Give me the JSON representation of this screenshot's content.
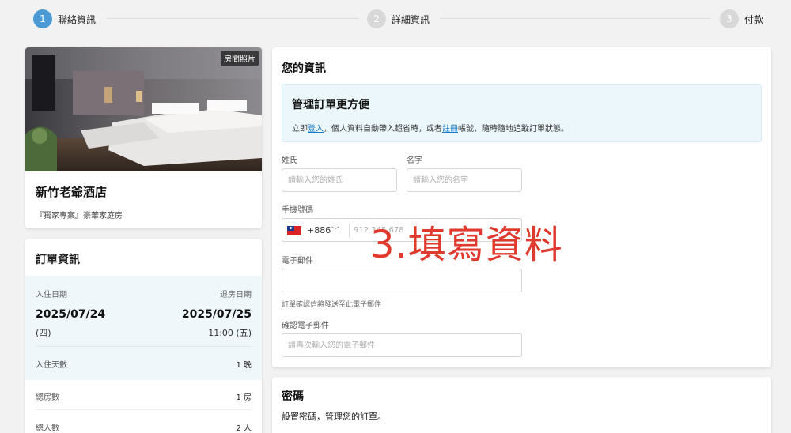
{
  "stepper": {
    "steps": [
      {
        "num": "1",
        "label": "聯絡資訊"
      },
      {
        "num": "2",
        "label": "詳細資訊"
      },
      {
        "num": "3",
        "label": "付款"
      }
    ]
  },
  "hotel": {
    "photo_badge": "房間照片",
    "name": "新竹老爺酒店",
    "room_type": "『獨家專案』豪華家庭房"
  },
  "order": {
    "title": "訂單資訊",
    "checkin_label": "入住日期",
    "checkout_label": "退房日期",
    "checkin_date": "2025/07/24",
    "checkin_sub": "(四)",
    "checkout_date": "2025/07/25",
    "checkout_sub": "11:00 (五)",
    "rows": [
      {
        "label": "入住天數",
        "value": "1 晚"
      },
      {
        "label": "總房數",
        "value": "1 房"
      },
      {
        "label": "總人數",
        "value": "2 人"
      }
    ]
  },
  "info": {
    "title": "您的資訊",
    "promo_title": "管理訂單更方便",
    "promo_prefix": "立即",
    "promo_login": "登入",
    "promo_mid": "，個人資料自動帶入超省時，或者",
    "promo_register": "註冊",
    "promo_suffix": "帳號，隨時隨地追蹤訂單狀態。",
    "last_name_label": "姓氏",
    "last_name_placeholder": "請輸入您的姓氏",
    "first_name_label": "名字",
    "first_name_placeholder": "請輸入您的名字",
    "phone_label": "手機號碼",
    "dial_code": "+886",
    "phone_placeholder": "912 345 678",
    "email_label": "電子郵件",
    "email_value": "",
    "email_note": "訂單確認信將發送至此電子郵件",
    "confirm_email_label": "確認電子郵件",
    "confirm_email_placeholder": "請再次輸入您的電子郵件"
  },
  "overlay": {
    "text": "3.填寫資料"
  },
  "password": {
    "title": "密碼",
    "desc": "設置密碼，管理您的訂單。"
  },
  "colors": {
    "accent": "#4a9ad6",
    "overlay": "#e03a2e",
    "link": "#1a7bc7",
    "promo_bg": "#ecf7fc"
  }
}
